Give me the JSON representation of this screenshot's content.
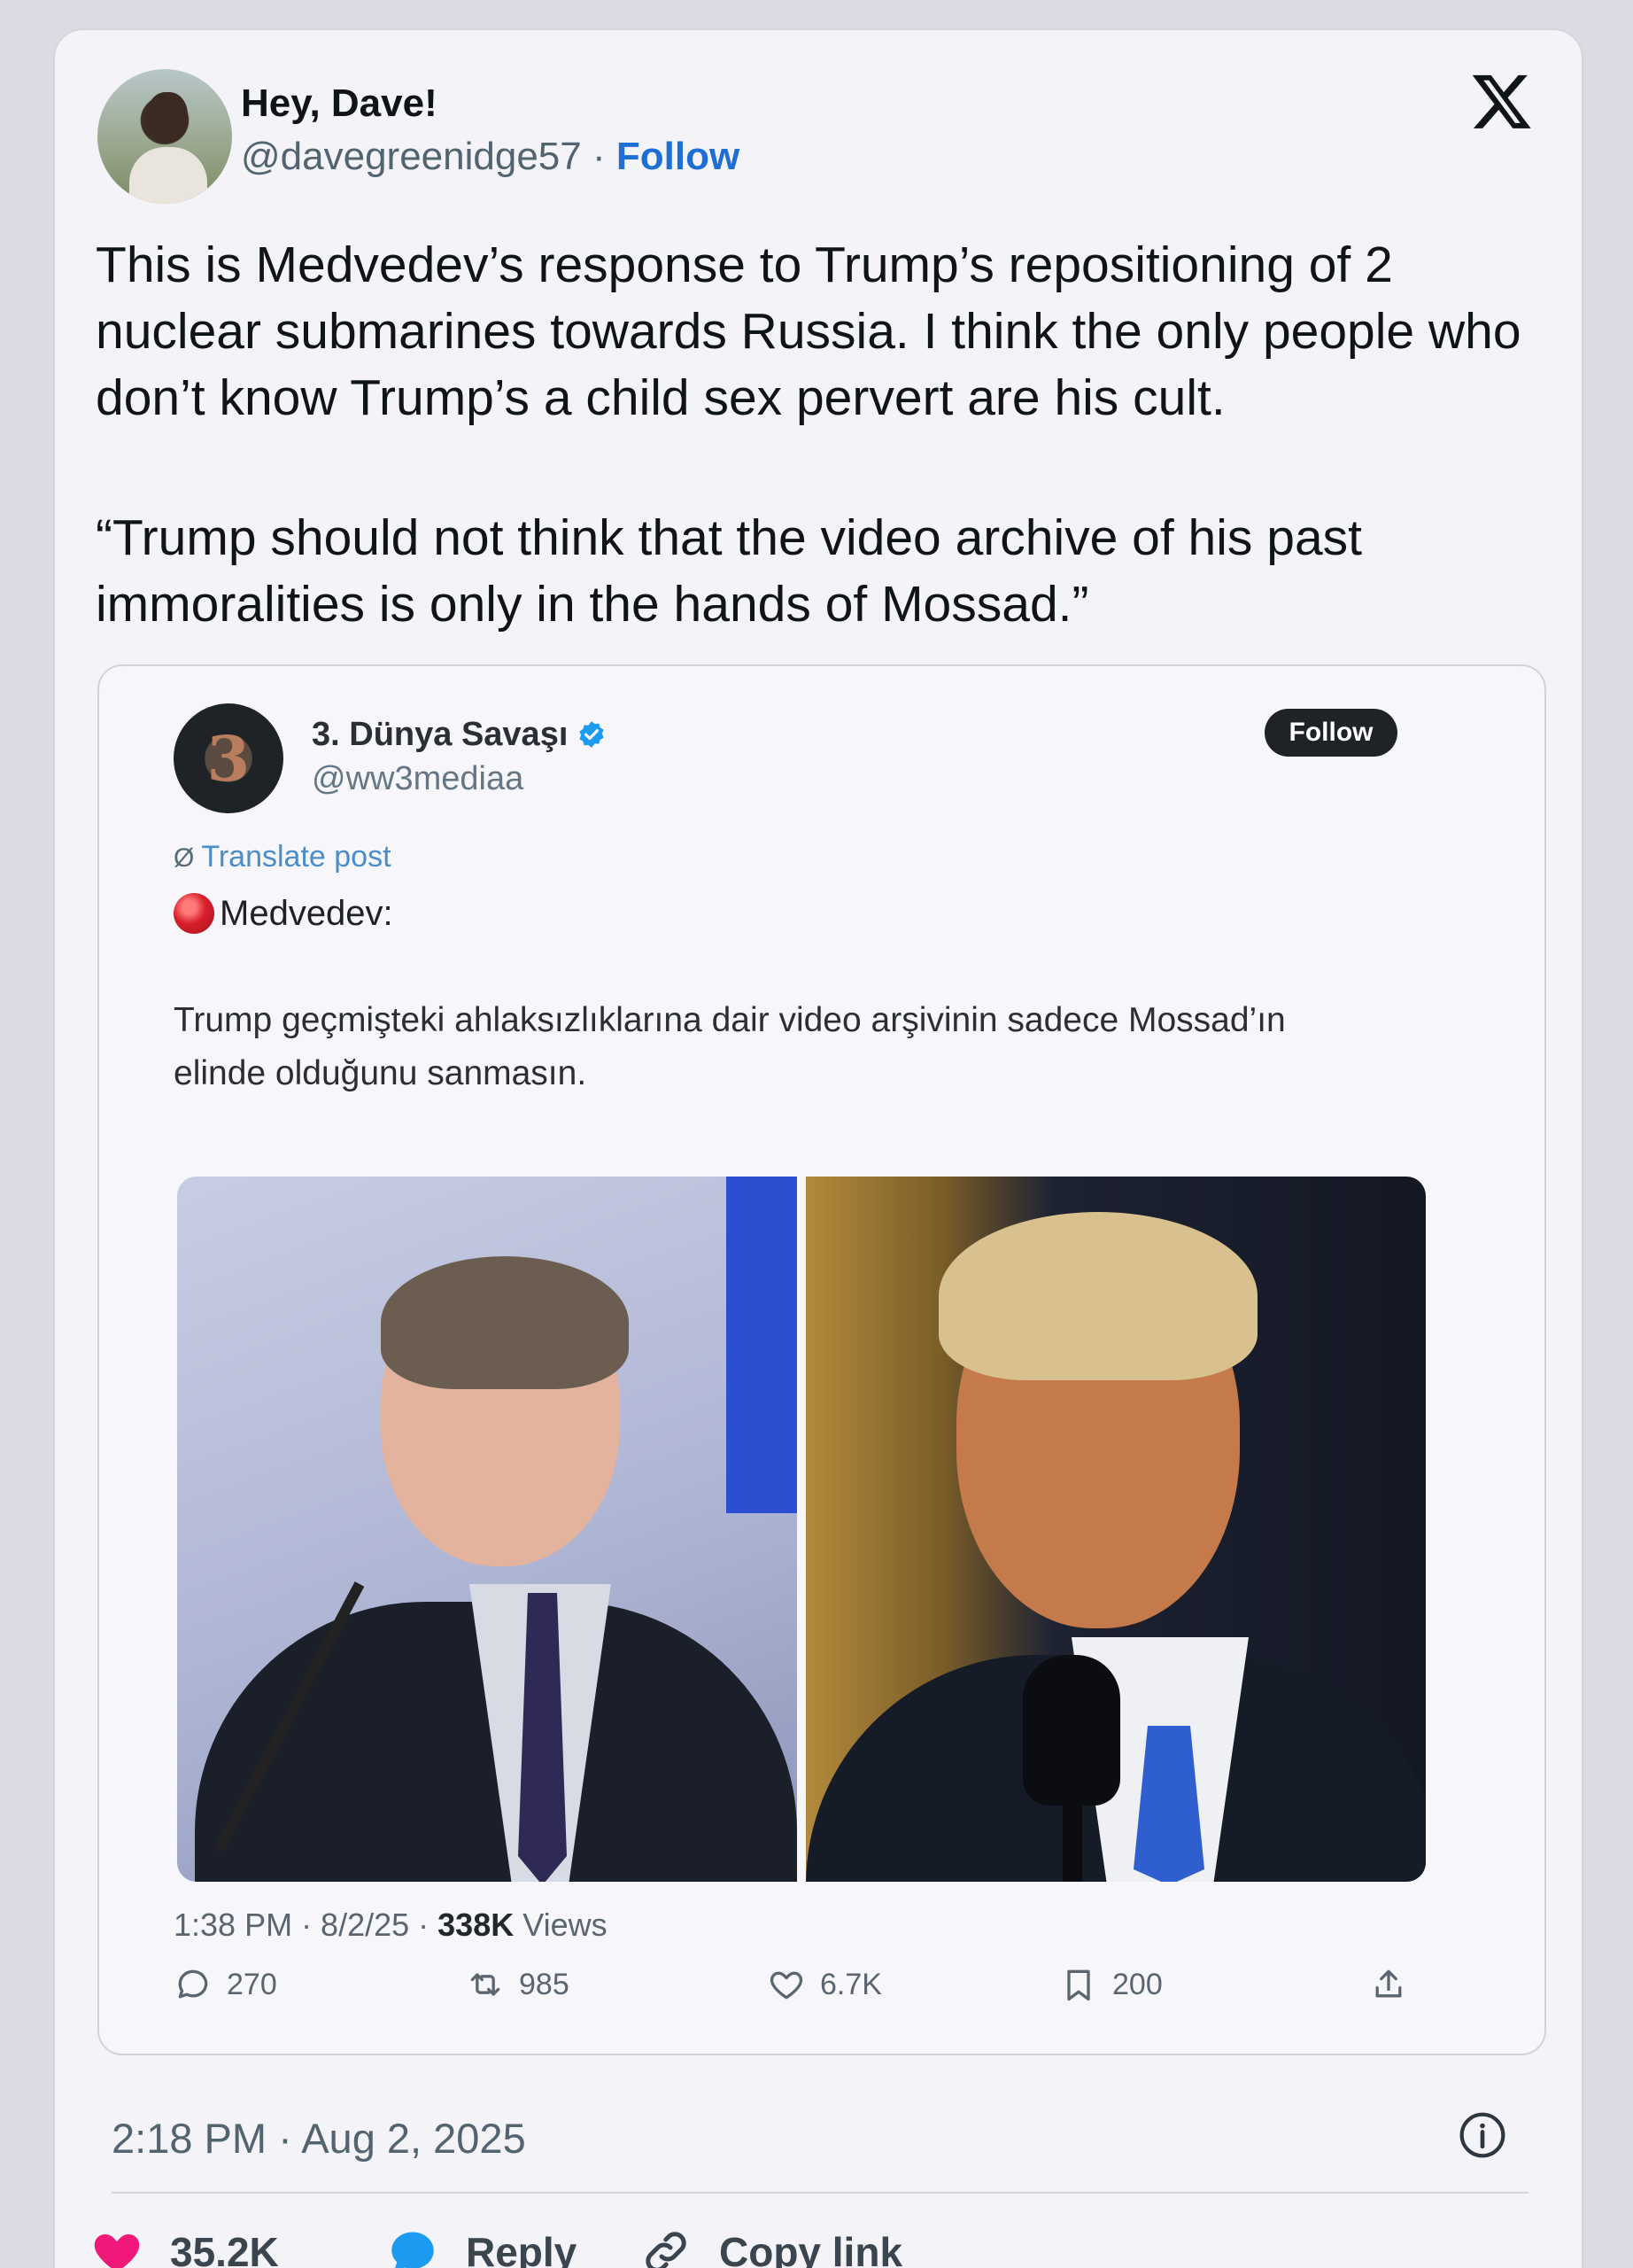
{
  "tweet": {
    "author_name": "Hey, Dave!",
    "author_handle": "@davegreenidge57",
    "separator": "·",
    "follow_label": "Follow",
    "text_paragraph_1": "This is Medvedev’s response to Trump’s repositioning of 2 nuclear submarines towards Russia. I think the only people who don’t know Trump’s a child sex pervert are his cult.",
    "text_paragraph_2": "“Trump should not think that the video archive of his past immoralities is only in the hands of Mossad.”",
    "timestamp": "2:18 PM · Aug 2, 2025",
    "likes": "35.2K",
    "reply_label": "Reply",
    "copy_link_label": "Copy link"
  },
  "quoted": {
    "avatar_glyph": "3",
    "author_name": "3. Dünya Savaşı",
    "author_handle": "@ww3mediaa",
    "follow_label": "Follow",
    "translate_label": "Translate post",
    "first_line": "Medvedev:",
    "body": "Trump geçmişteki ahlaksızlıklarına dair video arşivinin sadece Mossad’ın elinde olduğunu sanmasın.",
    "meta_time": "1:38 PM · 8/2/25 · ",
    "meta_views_count": "338K",
    "meta_views_label": " Views",
    "replies": "270",
    "reposts": "985",
    "likes": "6.7K",
    "bookmarks": "200"
  },
  "colors": {
    "link_blue": "#1d6fd6",
    "heart_pink": "#f0197a",
    "reply_blue": "#1d9bf0",
    "verified_blue": "#1d9bf0"
  },
  "icons": {
    "platform": "x-logo-icon",
    "verified": "verified-badge-icon",
    "translate": "globe-icon",
    "info": "info-icon",
    "like": "heart-icon",
    "reply": "speech-bubble-icon",
    "copy": "link-icon"
  }
}
